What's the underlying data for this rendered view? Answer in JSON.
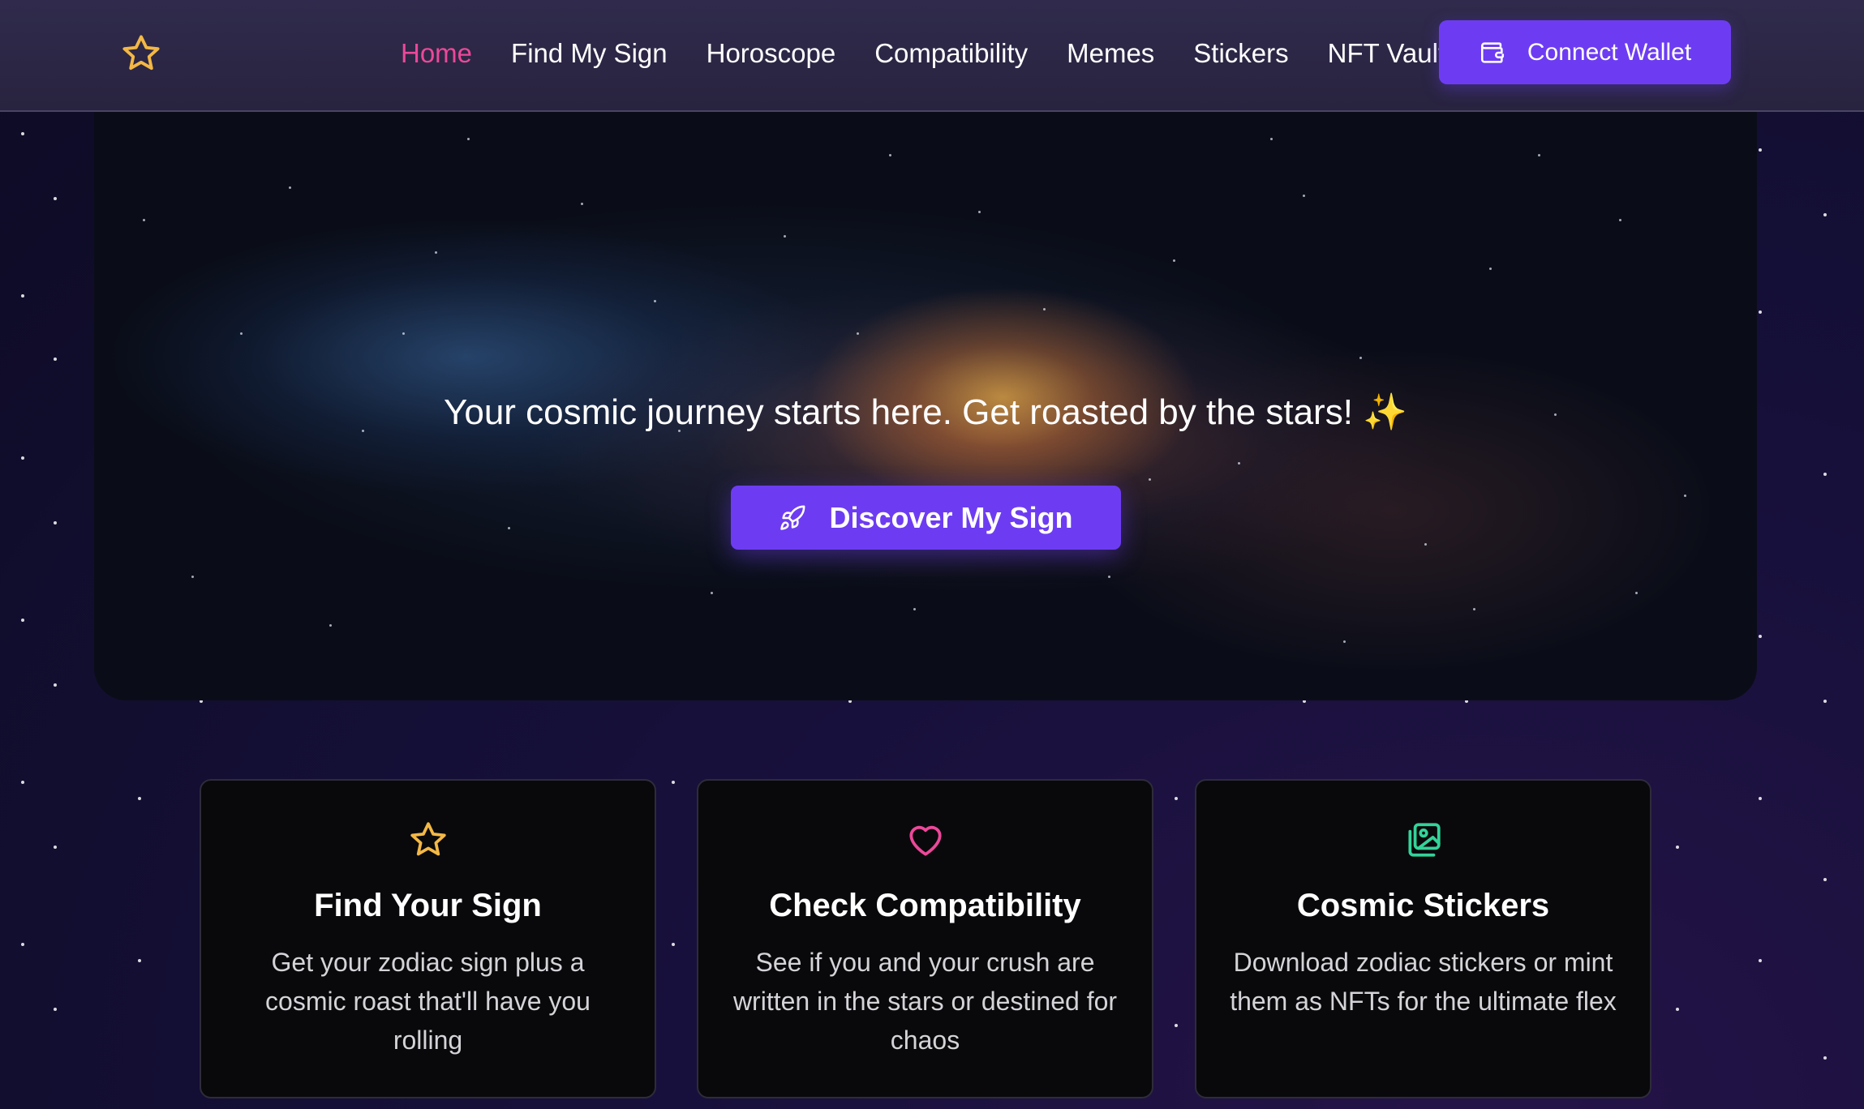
{
  "app": {
    "logo_icon": "star-icon",
    "logo_color": "#f3b845",
    "accent_color": "#6d3cf2",
    "active_color": "#ec4899"
  },
  "nav": {
    "links": [
      {
        "label": "Home",
        "active": true
      },
      {
        "label": "Find My Sign",
        "active": false
      },
      {
        "label": "Horoscope",
        "active": false
      },
      {
        "label": "Compatibility",
        "active": false
      },
      {
        "label": "Memes",
        "active": false
      },
      {
        "label": "Stickers",
        "active": false
      },
      {
        "label": "NFT Vault",
        "active": false
      }
    ],
    "wallet_button": {
      "label": "Connect Wallet",
      "icon": "wallet-icon"
    }
  },
  "hero": {
    "tagline": "Your cosmic journey starts here. Get roasted by the stars! ✨",
    "cta": {
      "label": "Discover My Sign",
      "icon": "rocket-icon"
    }
  },
  "features": [
    {
      "icon": "star-icon",
      "icon_color": "#f3b845",
      "title": "Find Your Sign",
      "description": "Get your zodiac sign plus a cosmic roast that'll have you rolling"
    },
    {
      "icon": "heart-icon",
      "icon_color": "#ec4899",
      "title": "Check Compatibility",
      "description": "See if you and your crush are written in the stars or destined for chaos"
    },
    {
      "icon": "image-gallery-icon",
      "icon_color": "#34d399",
      "title": "Cosmic Stickers",
      "description": "Download zodiac stickers or mint them as NFTs for the ultimate flex"
    }
  ]
}
